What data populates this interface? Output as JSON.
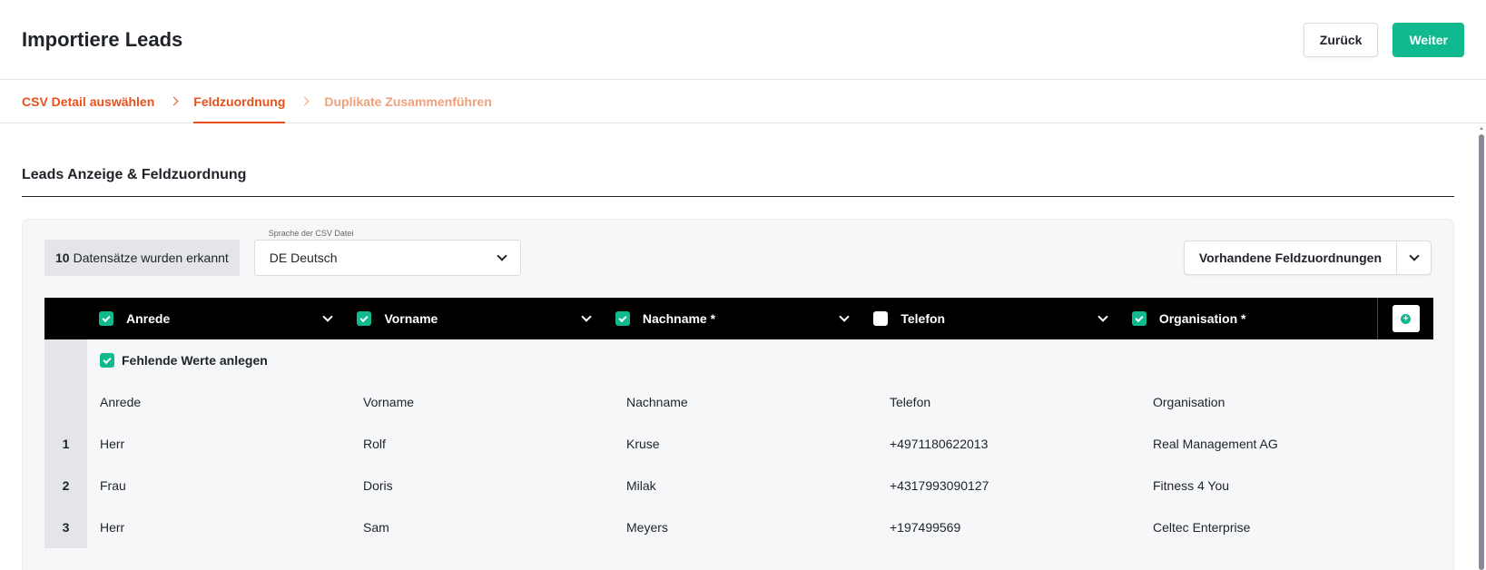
{
  "header": {
    "title": "Importiere Leads",
    "back_label": "Zurück",
    "next_label": "Weiter"
  },
  "steps": [
    {
      "label": "CSV Detail auswählen",
      "state": "done"
    },
    {
      "label": "Feldzuordnung",
      "state": "active"
    },
    {
      "label": "Duplikate Zusammenführen",
      "state": "pending"
    }
  ],
  "section": {
    "title": "Leads Anzeige & Feldzuordnung"
  },
  "toolbar": {
    "count": "10",
    "count_text": "Datensätze wurden erkannt",
    "language_label": "Sprache der CSV Datei",
    "language_value": "DE Deutsch",
    "mappings_label": "Vorhandene Feldzuordnungen"
  },
  "columns": [
    {
      "label": "Anrede",
      "checked": true
    },
    {
      "label": "Vorname",
      "checked": true
    },
    {
      "label": "Nachname *",
      "checked": true
    },
    {
      "label": "Telefon",
      "checked": false
    },
    {
      "label": "Organisation *",
      "checked": true
    }
  ],
  "missing_values_label": "Fehlende Werte anlegen",
  "csv_headers": [
    "Anrede",
    "Vorname",
    "Nachname",
    "Telefon",
    "Organisation"
  ],
  "rows": [
    {
      "index": "1",
      "cells": [
        "Herr",
        "Rolf",
        "Kruse",
        "+4971180622013",
        "Real Management AG"
      ]
    },
    {
      "index": "2",
      "cells": [
        "Frau",
        "Doris",
        "Milak",
        "+4317993090127",
        "Fitness 4 You"
      ]
    },
    {
      "index": "3",
      "cells": [
        "Herr",
        "Sam",
        "Meyers",
        "+197499569",
        "Celtec Enterprise"
      ]
    }
  ],
  "colors": {
    "accent_orange": "#e8501c",
    "accent_green": "#10b98e"
  }
}
